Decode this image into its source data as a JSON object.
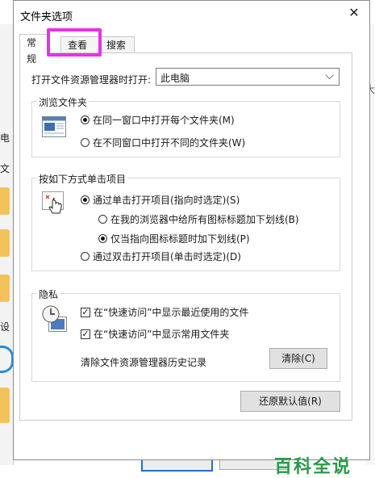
{
  "background": {
    "left_texts": [
      "电",
      "文",
      "设"
    ],
    "right_text": "大"
  },
  "dialog": {
    "title": "文件夹选项",
    "close_glyph": "✕",
    "tabs": [
      {
        "label": "常规",
        "active": true
      },
      {
        "label": "查看",
        "active": false,
        "highlighted": true
      },
      {
        "label": "搜索",
        "active": false
      }
    ],
    "open_explorer": {
      "label": "打开文件资源管理器时打开:",
      "value": "此电脑"
    },
    "browse_folders": {
      "title": "浏览文件夹",
      "options": [
        {
          "label": "在同一窗口中打开每个文件夹(M)",
          "selected": true
        },
        {
          "label": "在不同窗口中打开不同的文件夹(W)",
          "selected": false
        }
      ]
    },
    "click_items": {
      "title": "按如下方式单击项目",
      "options": [
        {
          "label": "通过单击打开项目(指向时选定)(S)",
          "selected": true
        },
        {
          "label": "在我的浏览器中给所有图标标题加下划线(B)",
          "selected": false
        },
        {
          "label": "仅当指向图标标题时加下划线(P)",
          "selected": true
        },
        {
          "label": "通过双击打开项目(单击时选定)(D)",
          "selected": false
        }
      ]
    },
    "privacy": {
      "title": "隐私",
      "checks": [
        {
          "label": "在“快速访问”中显示最近使用的文件",
          "checked": true
        },
        {
          "label": "在“快速访问”中显示常用文件夹",
          "checked": true
        }
      ],
      "clear_label": "清除文件资源管理器历史记录",
      "clear_button": "清除(C)"
    },
    "restore_button": "还原默认值(R)"
  },
  "watermark": "百科全说",
  "colors": {
    "highlight": "#e632e6",
    "watermark": "#2a9a4a"
  }
}
